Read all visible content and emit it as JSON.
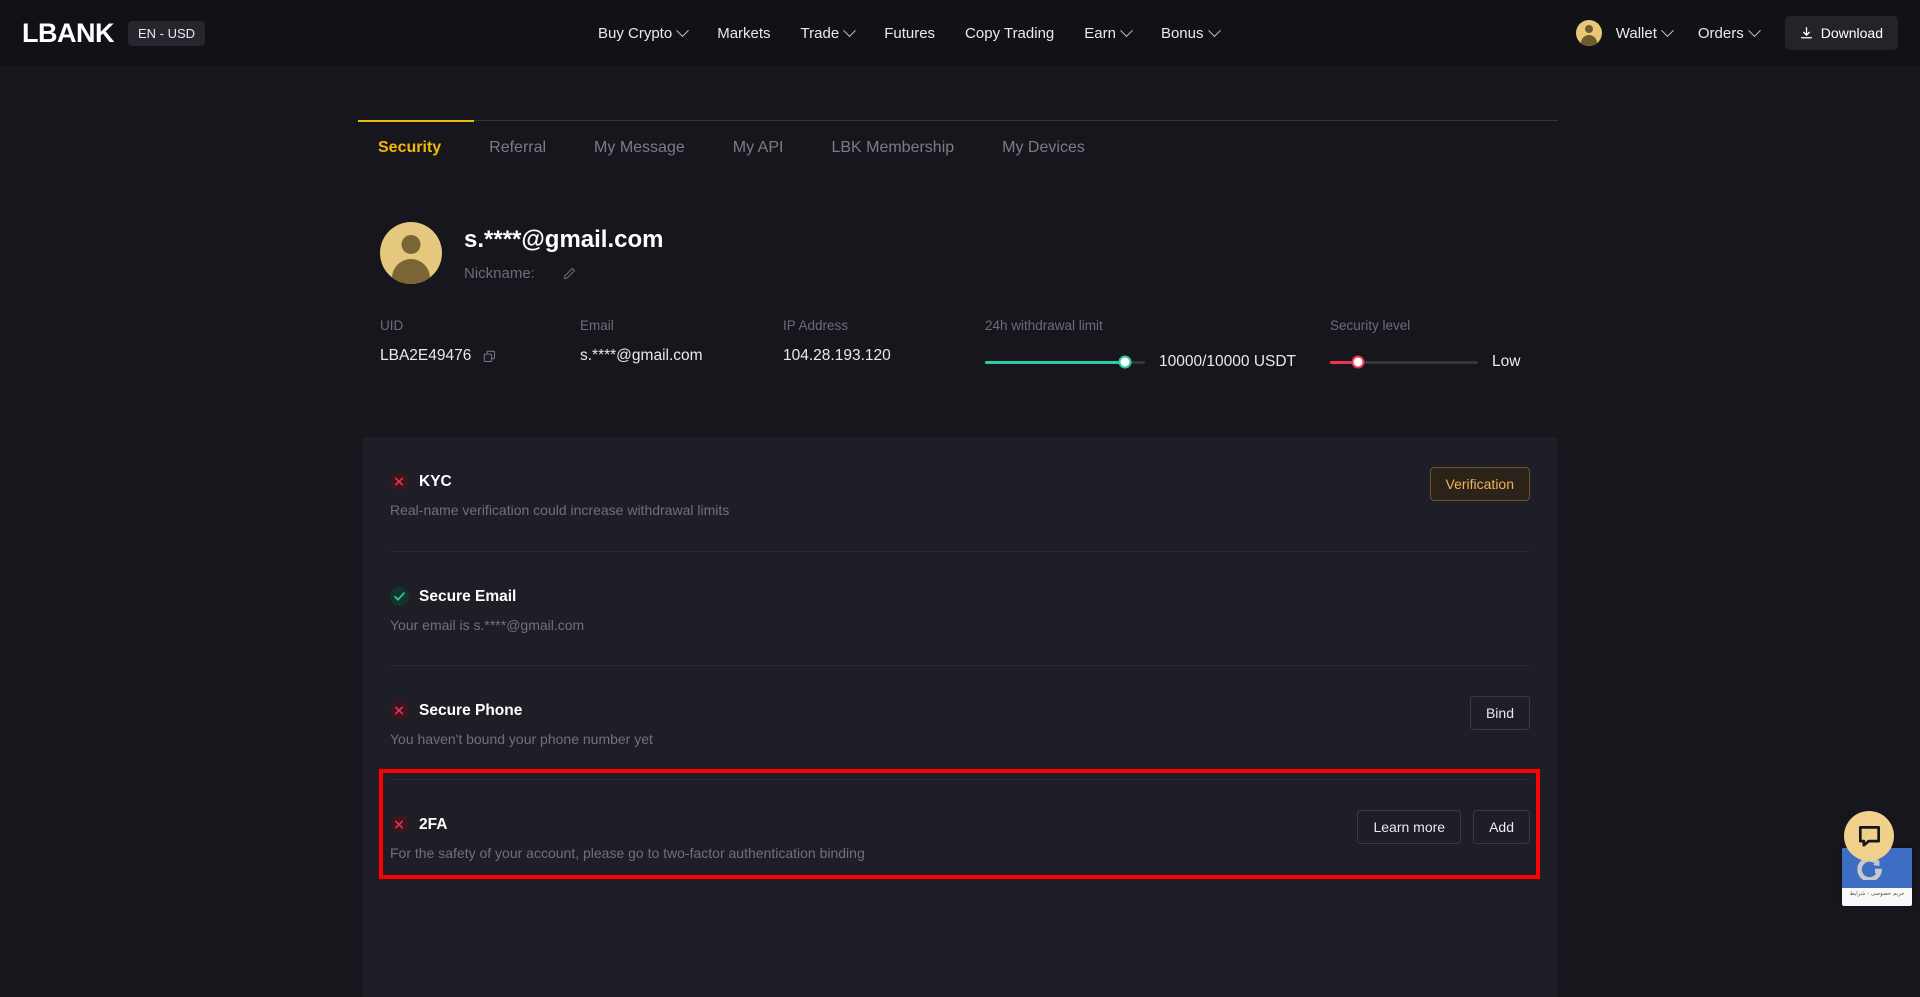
{
  "header": {
    "logo": "LBANK",
    "lang": "EN - USD",
    "nav": [
      {
        "label": "Buy Crypto",
        "caret": true
      },
      {
        "label": "Markets",
        "caret": false
      },
      {
        "label": "Trade",
        "caret": true
      },
      {
        "label": "Futures",
        "caret": false
      },
      {
        "label": "Copy Trading",
        "caret": false
      },
      {
        "label": "Earn",
        "caret": true
      },
      {
        "label": "Bonus",
        "caret": true
      }
    ],
    "wallet": "Wallet",
    "orders": "Orders",
    "download": "Download"
  },
  "tabs": [
    {
      "label": "Security",
      "active": true
    },
    {
      "label": "Referral",
      "active": false
    },
    {
      "label": "My Message",
      "active": false
    },
    {
      "label": "My API",
      "active": false
    },
    {
      "label": "LBK Membership",
      "active": false
    },
    {
      "label": "My Devices",
      "active": false
    }
  ],
  "profile": {
    "email": "s.****@gmail.com",
    "nickname_label": "Nickname:",
    "nickname_value": ""
  },
  "info": {
    "uid_label": "UID",
    "uid_value": "LBA2E49476",
    "email_label": "Email",
    "email_value": "s.****@gmail.com",
    "ip_label": "IP Address",
    "ip_value": "104.28.193.120",
    "withdrawal_label": "24h withdrawal limit",
    "withdrawal_value": "10000/10000 USDT",
    "security_label": "Security level",
    "security_value": "Low"
  },
  "sections": [
    {
      "title": "KYC",
      "desc": "Real-name verification could increase withdrawal limits",
      "status": "bad",
      "buttons": [
        {
          "label": "Verification",
          "style": "gold"
        }
      ]
    },
    {
      "title": "Secure Email",
      "desc": "Your email is s.****@gmail.com",
      "status": "ok",
      "buttons": []
    },
    {
      "title": "Secure Phone",
      "desc": "You haven't bound your phone number yet",
      "status": "bad",
      "buttons": [
        {
          "label": "Bind",
          "style": "ghost"
        }
      ]
    },
    {
      "title": "2FA",
      "desc": "For the safety of your account, please go to two-factor authentication binding",
      "status": "bad",
      "buttons": [
        {
          "label": "Learn more",
          "style": "ghost"
        },
        {
          "label": "Add",
          "style": "ghost"
        }
      ]
    }
  ],
  "widgets": {
    "recaptcha_text": "حریم خصوصی - شرایط"
  },
  "colors": {
    "accent_gold": "#f0b90b",
    "page_bg": "#16161c",
    "header_bg": "#121116",
    "card_bg": "#1e1e26",
    "success": "#2ecba0",
    "danger": "#f0334f",
    "highlight": "#fe0000"
  }
}
